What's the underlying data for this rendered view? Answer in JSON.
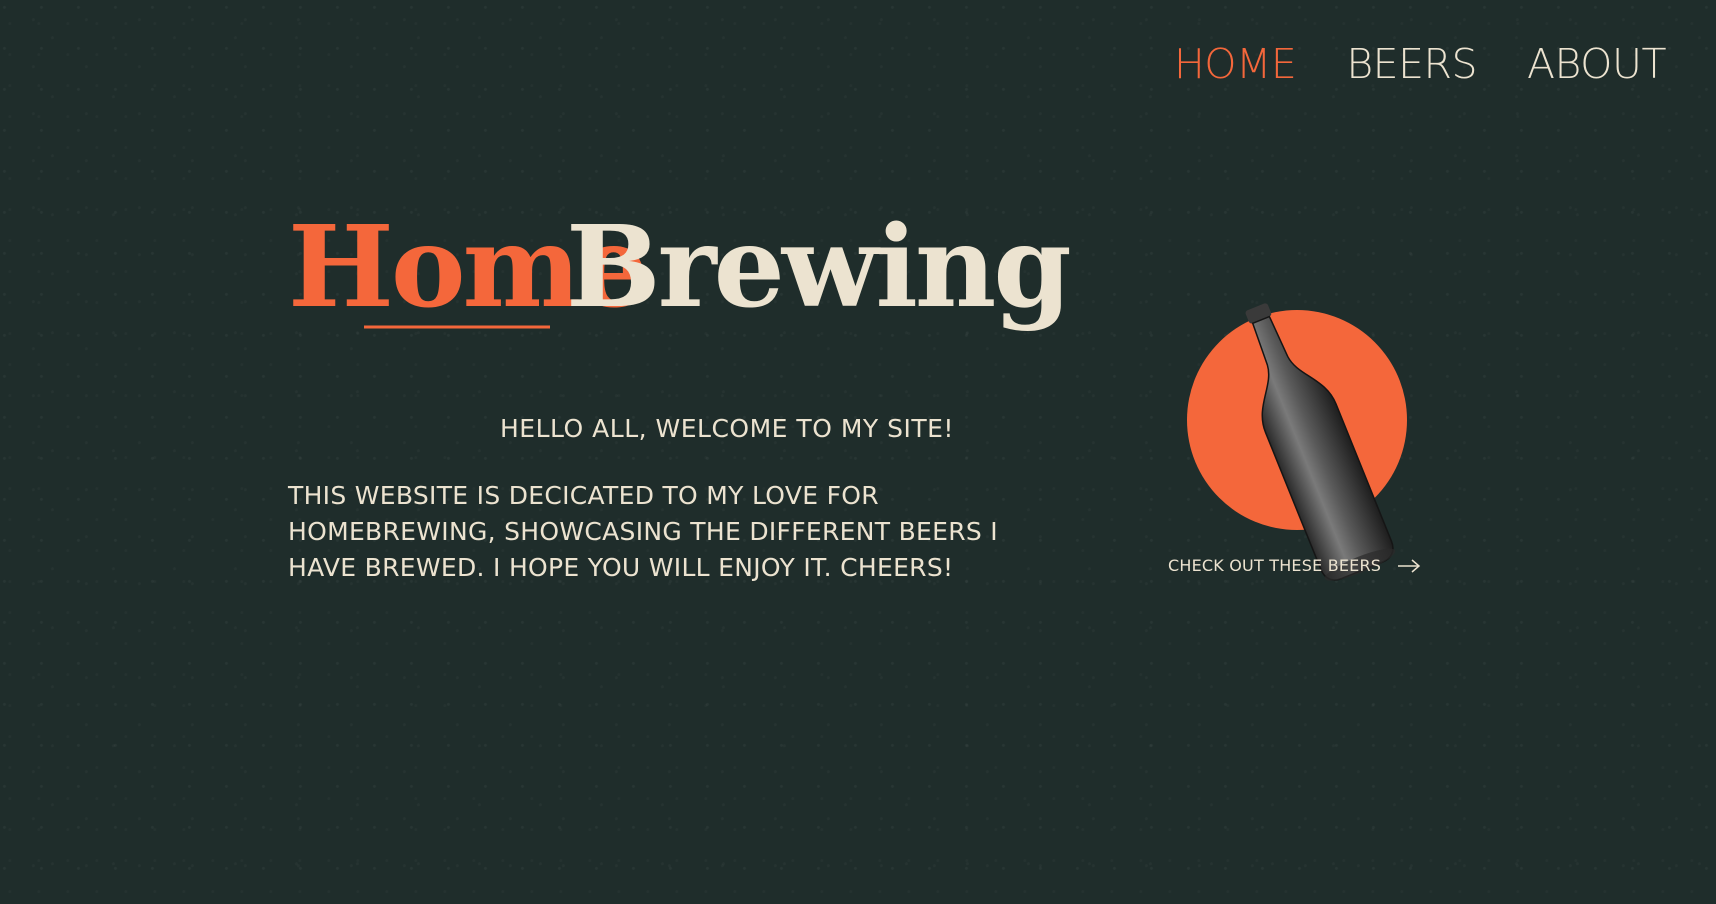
{
  "nav": {
    "items": [
      {
        "label": "HOME",
        "active": true
      },
      {
        "label": "BEERS",
        "active": false
      },
      {
        "label": "ABOUT",
        "active": false
      }
    ]
  },
  "hero": {
    "logo_word_1": "Home",
    "logo_word_2": "Brewing",
    "welcome": "HELLO ALL, WELCOME TO MY SITE!",
    "intro": "THIS WEBSITE IS DECICATED TO MY LOVE FOR HOMEBREWING, SHOWCASING THE DIFFERENT BEERS I HAVE BREWED. I HOPE YOU WILL ENJOY IT. CHEERS!"
  },
  "feature": {
    "image": "beer-bottle",
    "cta_label": "CHECK OUT THESE BEERS",
    "cta_icon": "arrow-right-icon"
  },
  "colors": {
    "background": "#1f2d2b",
    "accent": "#f4673b",
    "text": "#ece3d0"
  }
}
